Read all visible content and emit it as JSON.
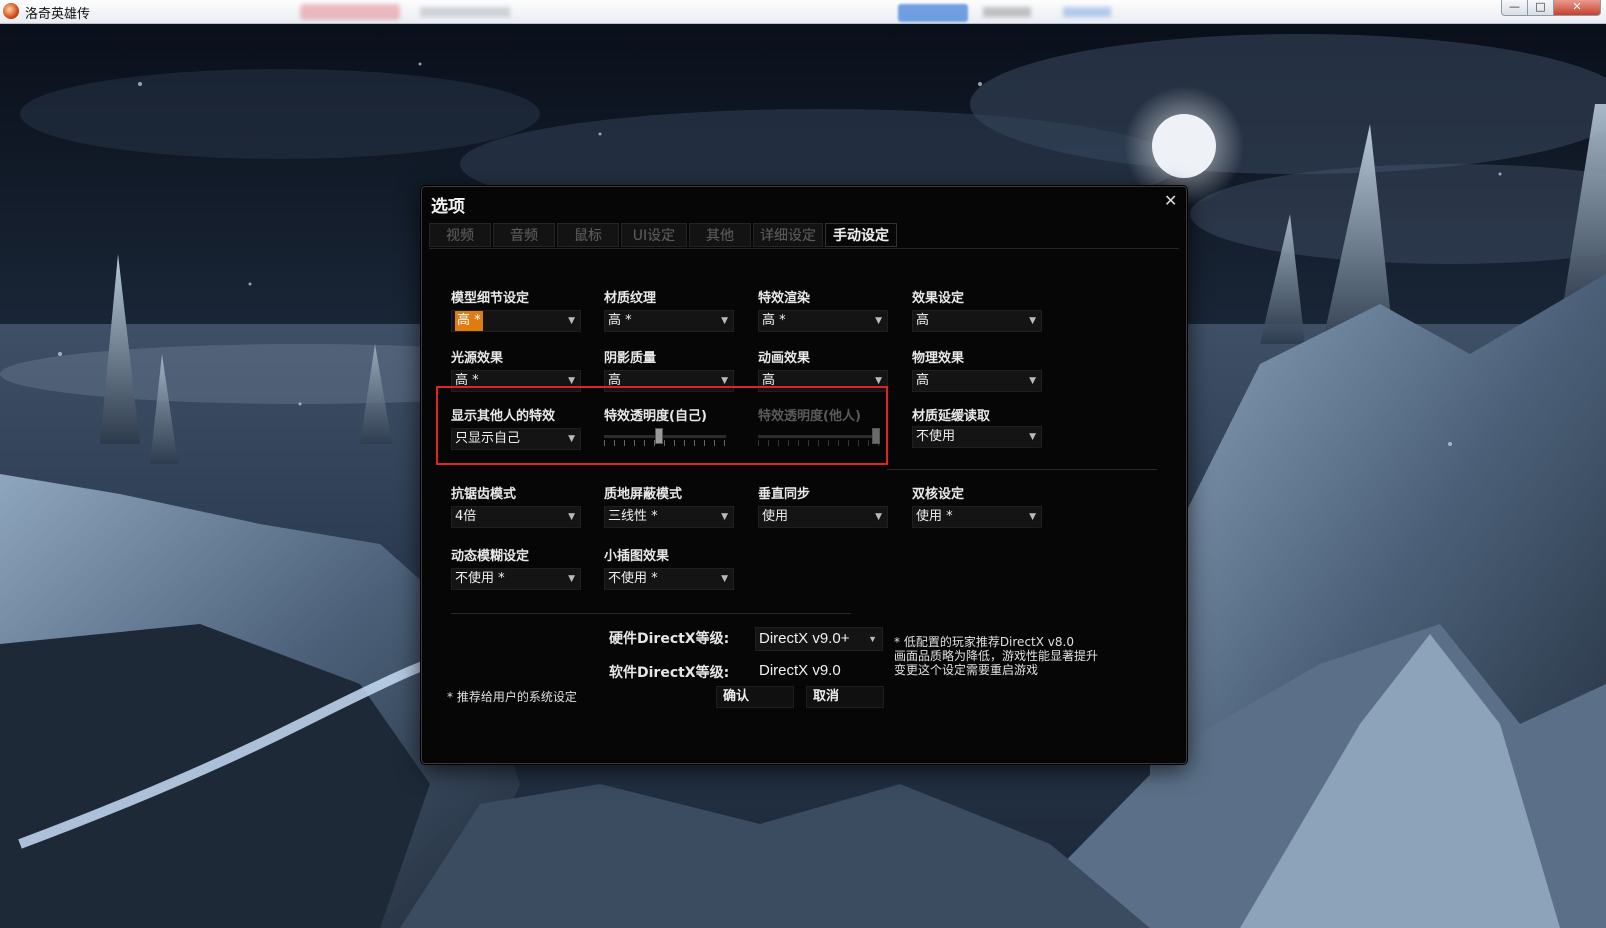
{
  "window": {
    "title": "洛奇英雄传",
    "min_glyph": "—",
    "max_glyph": "□",
    "close_glyph": "✕"
  },
  "dialog": {
    "title": "选项",
    "close_glyph": "✕",
    "tabs": [
      "视频",
      "音频",
      "鼠标",
      "UI设定",
      "其他",
      "详细设定",
      "手动设定"
    ],
    "active_tab": "手动设定",
    "settings": {
      "model_detail": {
        "label": "模型细节设定",
        "value": "高 *"
      },
      "texture": {
        "label": "材质纹理",
        "value": "高 *"
      },
      "effect_render": {
        "label": "特效渲染",
        "value": "高 *"
      },
      "effect_setting": {
        "label": "效果设定",
        "value": "高"
      },
      "light_effect": {
        "label": "光源效果",
        "value": "高 *"
      },
      "shadow_quality": {
        "label": "阴影质量",
        "value": "高"
      },
      "animation_effect": {
        "label": "动画效果",
        "value": "高"
      },
      "physics_effect": {
        "label": "物理效果",
        "value": "高"
      },
      "show_others_effects": {
        "label": "显示其他人的特效",
        "value": "只显示自己"
      },
      "effect_alpha_self": {
        "label": "特效透明度(自己)",
        "level": 0.45
      },
      "effect_alpha_others": {
        "label": "特效透明度(他人)",
        "level": 1.0
      },
      "texture_lazy_load": {
        "label": "材质延缓读取",
        "value": "不使用"
      },
      "antialias": {
        "label": "抗锯齿模式",
        "value": "4倍"
      },
      "texture_filter": {
        "label": "质地屏蔽模式",
        "value": "三线性 *"
      },
      "vsync": {
        "label": "垂直同步",
        "value": "使用"
      },
      "dual_core": {
        "label": "双核设定",
        "value": "使用 *"
      },
      "motion_blur": {
        "label": "动态模糊设定",
        "value": "不使用 *"
      },
      "minimap_effect": {
        "label": "小插图效果",
        "value": "不使用 *"
      }
    },
    "directx": {
      "hw_label": "硬件DirectX等级:",
      "hw_value": "DirectX v9.0+",
      "sw_label": "软件DirectX等级:",
      "sw_value": "DirectX v9.0"
    },
    "note_lines": [
      "* 低配置的玩家推荐DirectX v8.0",
      "画面品质略为降低，游戏性能显著提升",
      "变更这个设定需要重启游戏"
    ],
    "recommend_note": "* 推荐给用户的系统设定",
    "confirm_label": "确认",
    "cancel_label": "取消",
    "dropdown_arrow": "▼"
  },
  "colors": {
    "highlight_box": "#e0222a",
    "selected_value": "#e07b10"
  }
}
